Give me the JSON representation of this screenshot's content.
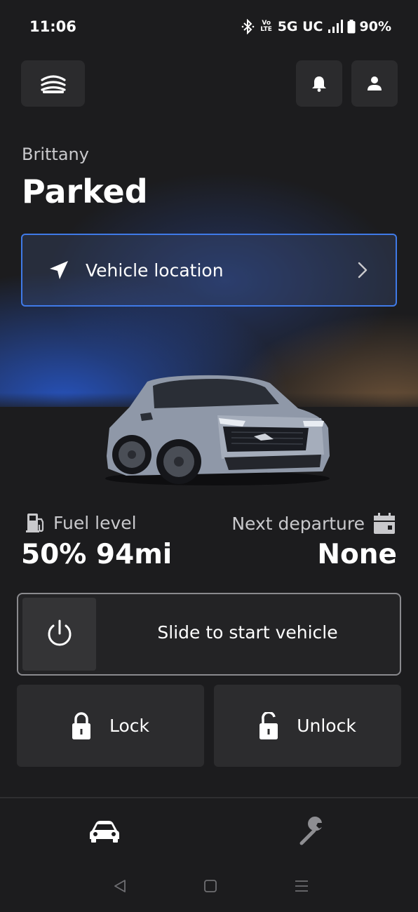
{
  "status_bar": {
    "time": "11:06",
    "volte_top": "Vo",
    "volte_bottom": "LTE",
    "network": "5G UC",
    "battery": "90%",
    "icons": [
      "bluetooth-icon",
      "signal-icon",
      "battery-icon"
    ]
  },
  "header": {
    "owner_name": "Brittany",
    "vehicle_state": "Parked",
    "icons": [
      "garage-menu-icon",
      "bell-icon",
      "profile-icon"
    ]
  },
  "location_card": {
    "label": "Vehicle location",
    "icons": [
      "navigation-arrow-icon",
      "chevron-right-icon"
    ]
  },
  "vehicle_image": "car-image",
  "stats": {
    "fuel_label": "Fuel level",
    "fuel_value": "50% 94mi",
    "departure_label": "Next departure",
    "departure_value": "None",
    "icons": [
      "fuel-pump-icon",
      "calendar-icon"
    ]
  },
  "remote_start": {
    "label": "Slide to start vehicle",
    "icon": "power-icon"
  },
  "actions": {
    "lock_label": "Lock",
    "unlock_label": "Unlock",
    "icons": [
      "lock-icon",
      "unlock-icon"
    ]
  },
  "bottom_tabs": {
    "icons": [
      "car-icon",
      "wrench-icon"
    ]
  },
  "colors": {
    "background": "#1c1c1e",
    "accent_blue": "#3f7ae8",
    "card": "#2c2c2e",
    "secondary_text": "#c9c9cc"
  }
}
